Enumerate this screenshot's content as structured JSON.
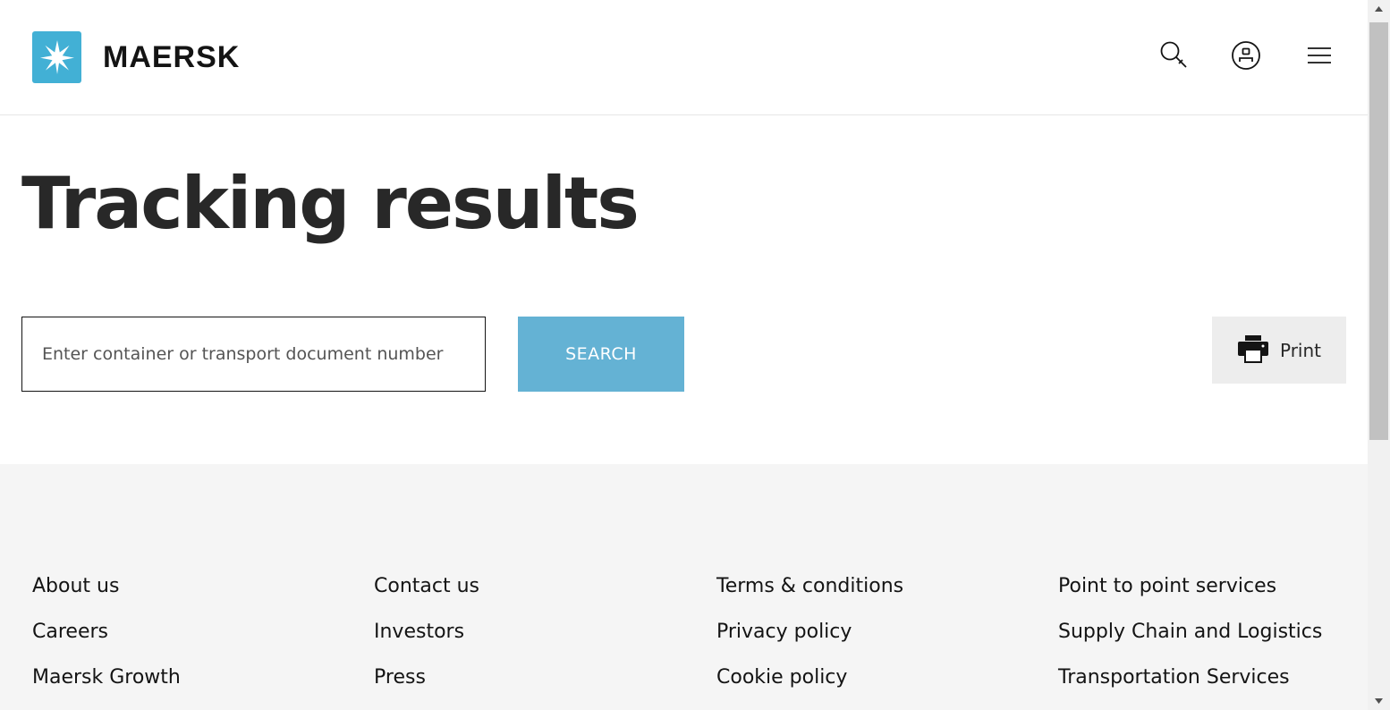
{
  "header": {
    "brand": "MAERSK",
    "icons": {
      "search": "search-icon",
      "user": "user-icon",
      "menu": "menu-icon"
    }
  },
  "main": {
    "title": "Tracking results",
    "search": {
      "placeholder": "Enter container or transport document number",
      "value": "",
      "button_label": "SEARCH"
    },
    "print_label": "Print"
  },
  "footer": {
    "columns": [
      [
        "About us",
        "Careers",
        "Maersk Growth"
      ],
      [
        "Contact us",
        "Investors",
        "Press"
      ],
      [
        "Terms & conditions",
        "Privacy policy",
        "Cookie policy"
      ],
      [
        "Point to point services",
        "Supply Chain and Logistics",
        "Transportation Services"
      ]
    ]
  },
  "colors": {
    "brand": "#42b0d5",
    "search_button": "#64b2d4",
    "footer_bg": "#f5f5f5",
    "print_bg": "#ededed"
  }
}
